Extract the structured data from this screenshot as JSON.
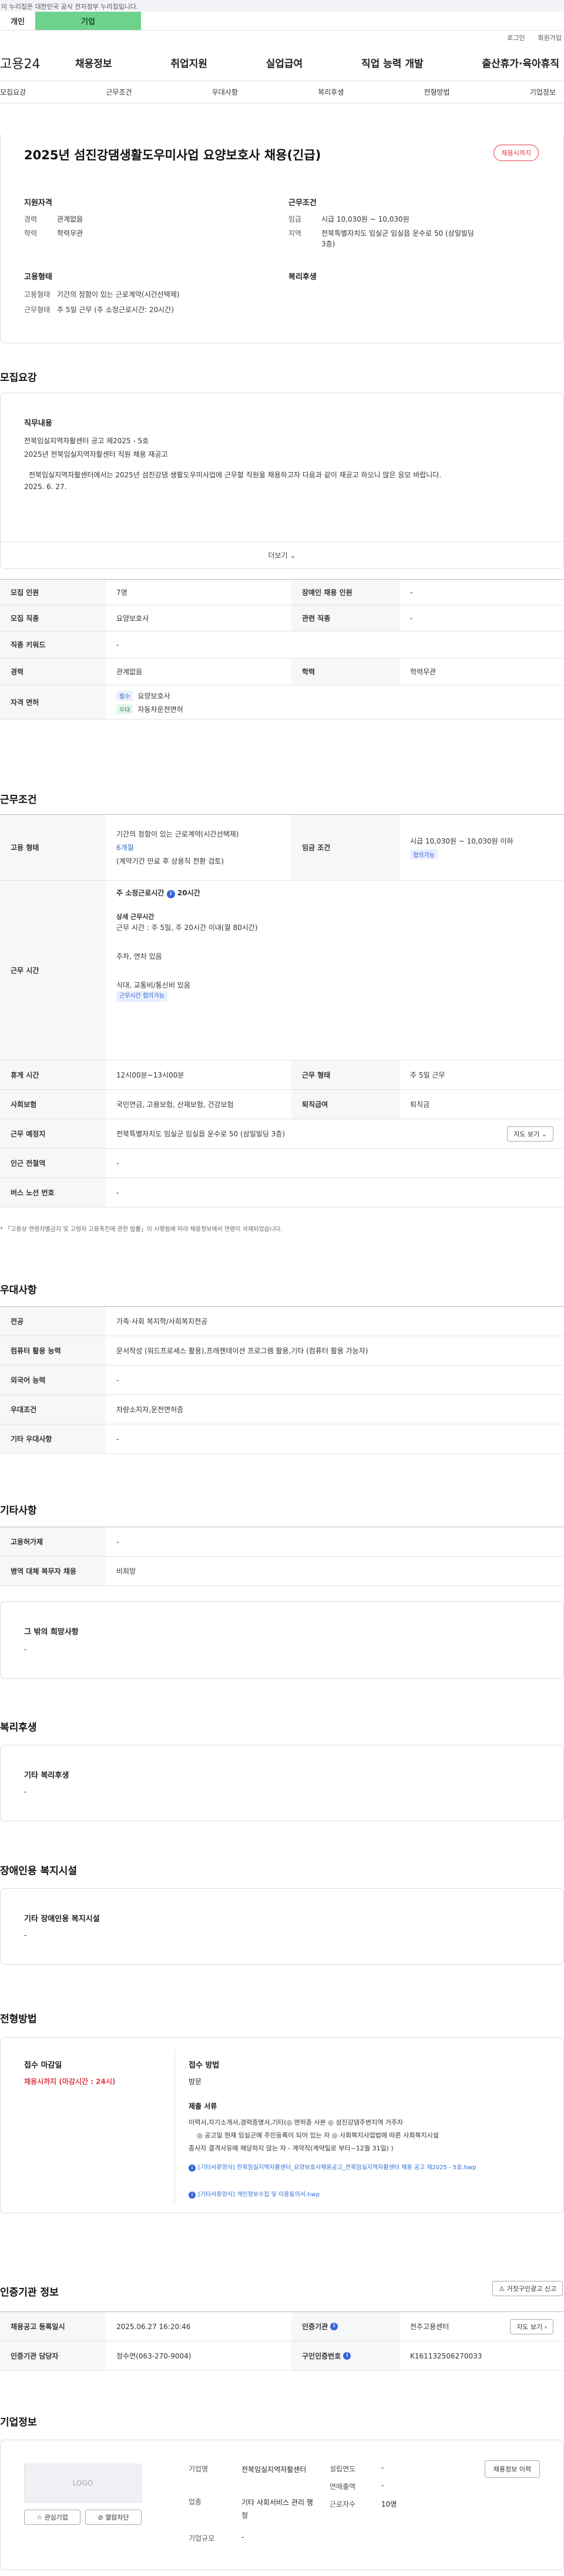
{
  "gov_banner": "이 누리집은 대한민국 공식 전자정부 누리집입니다.",
  "top_tabs": [
    "개인",
    "기업"
  ],
  "utility": {
    "login": "로그인",
    "signup": "회원가입"
  },
  "brand": {
    "logo": "고용24"
  },
  "gnb": [
    "채용정보",
    "취업지원",
    "실업급여",
    "직업 능력 개발",
    "출산휴가·육아휴직"
  ],
  "subtabs": [
    "모집요강",
    "근무조건",
    "우대사항",
    "복리후생",
    "전형방법",
    "기업정보"
  ],
  "summary": {
    "title": "2025년 섬진강댐생활도우미사업 요양보호사 채용(긴급)",
    "badge": "채용시까지",
    "qual_head": "지원자격",
    "qual": [
      {
        "k": "경력",
        "v": "관계없음"
      },
      {
        "k": "학력",
        "v": "학력무관"
      }
    ],
    "cond_head": "근무조건",
    "cond": [
      {
        "k": "임금",
        "v": "시급 10,030원 ~ 10,030원"
      },
      {
        "k": "지역",
        "v": "전북특별자치도 임실군 임실읍 운수로 50 (삼일빌딩 3층)"
      }
    ],
    "emp_head": "고용형태",
    "emp": [
      {
        "k": "고용형태",
        "v": "기간의 정함이 있는 근로계약(시간선택제)"
      },
      {
        "k": "근무형태",
        "v": "주 5일 근무 (주 소정근로시간: 20시간)"
      }
    ],
    "welfare_head": "복리후생"
  },
  "recruit": {
    "heading": "모집요강",
    "duty_head": "직무내용",
    "duty_lines": [
      "전북임실지역자활센터 공고 제2025 - 5호",
      "2025년 전북임실지역자활센터 직원 채용 재공고",
      "",
      "전북임실지역자활센터에서는 2025년 섬진강댐 생활도우미사업에 근무할 직원을 채용하고자 다음과 같이 재공고 하오니 많은 응모 바랍니다.",
      "2025.  6.  27."
    ],
    "more": "더보기",
    "rows": [
      {
        "k1": "모집 인원",
        "v1": "7명",
        "k2": "장애인 채용 인원",
        "v2": "-"
      },
      {
        "k1": "모집 직종",
        "v1": "요양보호사",
        "k2": "관련 직종",
        "v2": "-"
      },
      {
        "k1": "직종 키워드",
        "v1": "-"
      },
      {
        "k1": "경력",
        "v1": "관계없음",
        "k2": "학력",
        "v2": "학력무관"
      }
    ],
    "license_label": "자격 면허",
    "licenses": [
      {
        "tag": "필수",
        "name": "요양보호사"
      },
      {
        "tag": "우대",
        "name": "자동차운전면허"
      }
    ]
  },
  "work": {
    "heading": "근무조건",
    "emp_label": "고용 형태",
    "emp_value": "기간의 정함이 있는 근로계약(시간선택제)",
    "emp_period": "6개월",
    "emp_note": "(계약기간 만료 후 상용직 전환 검토)",
    "wage_label": "임금 조건",
    "wage_value": "시급 10,030원 ~ 10,030원 이하",
    "wage_chip": "협의가능",
    "time_label": "근무 시간",
    "time_weekly": "주 소정근로시간",
    "time_weekly_val": "20시간",
    "time_detail_head": "상세 근무시간",
    "time_detail": "근무 시간 : 주 5일, 주 20시간 이내(월 80시간)",
    "time_extra1": "주차, 연차 있음",
    "time_extra2": "식대, 교통비/통신비 있음",
    "time_chip": "근무시간 협의가능",
    "rows": [
      {
        "k1": "휴게 시간",
        "v1": "12시00분~13시00분",
        "k2": "근무 형태",
        "v2": "주 5일 근무"
      },
      {
        "k1": "사회보험",
        "v1": "국민연금, 고용보험, 산재보험, 건강보험",
        "k2": "퇴직급여",
        "v2": "퇴직금"
      }
    ],
    "place_label": "근무 예정지",
    "place_value": "전북특별자치도 임실군 임실읍 운수로 50 (삼일빌딩 3층)",
    "map_btn": "지도 보기",
    "station_label": "인근 전철역",
    "station_value": "-",
    "bus_label": "버스 노선 번호",
    "bus_value": "-",
    "footnote": "* 「고용상 연령차별금지 및 고령자 고용촉진에 관한 법률」이 시행됨에 따라 채용정보에서 연령이 삭제되었습니다."
  },
  "prefer": {
    "heading": "우대사항",
    "rows": [
      {
        "k": "전공",
        "v": "가족·사회 복지학/사회복지전공"
      },
      {
        "k": "컴퓨터 활용 능력",
        "v": "문서작성 (워드프로세스 활용),프레젠테이션 프로그램 활용,기타 (컴퓨터 활용 가능자)"
      },
      {
        "k": "외국어 능력",
        "v": "-"
      },
      {
        "k": "우대조건",
        "v": "차량소지자,운전면허증"
      },
      {
        "k": "기타 우대사항",
        "v": "-"
      }
    ]
  },
  "etc": {
    "heading": "기타사항",
    "rows": [
      {
        "k": "고용허가제",
        "v": "-"
      },
      {
        "k": "병역 대체 복무자 채용",
        "v": "비희망"
      }
    ],
    "hope_head": "그 밖의 희망사항",
    "hope_value": "-"
  },
  "welfare": {
    "heading": "복리후생",
    "sub": "기타 복리후생",
    "value": "-"
  },
  "disabled": {
    "heading": "장애인용 복지시설",
    "sub": "기타 장애인용 복지시설",
    "value": "-"
  },
  "screening": {
    "heading": "전형방법",
    "deadline_head": "접수 마감일",
    "deadline_val": "채용시까지 (마감시간 : 24시)",
    "method_head": "접수 방법",
    "method_val": "방문",
    "docs_head": "제출 서류",
    "docs_lines": [
      "이력서,자기소개서,경력증명서,기타(◎ 면허증 사본 ◎ 성진강댐주변지역 거주자",
      "◎ 공고일 현재 임실군에 주민등록이 되어 있는 자 ◎ 사회복지사업법에 따른 사회복지시설",
      "종사자 결격사유에 해당하지 않는 자 - 계약직(계약일로 부터~12월 31일) )"
    ],
    "file1": "[기타서류양식] 전북임실지역자활센터_요양보호사채용공고_전북임실지역자활센터 채용 공고 제2025 - 5호.hwp",
    "file2": "[기타서류양식] 개인정보수집 및 이용동의서.hwp"
  },
  "agency": {
    "heading": "인증기관 정보",
    "report_btn": "거짓구인광고 신고",
    "rows": [
      {
        "k1": "채용공고 등록일시",
        "v1": "2025.06.27 16:20:46",
        "k2": "인증기관",
        "v2": "전주고용센터"
      },
      {
        "k1": "인증기관 담당자",
        "v1": "정수연(063-270-9004)",
        "k2": "구인인증번호",
        "v2": "K161132506270033"
      }
    ],
    "map_btn": "지도 보기"
  },
  "company": {
    "heading": "기업정보",
    "logo": "LOGO",
    "fav_btn": "관심기업",
    "block_btn": "열람차단",
    "name_k": "기업명",
    "name_v": "전북임실지역자활센터",
    "biz_k": "업종",
    "biz_v": "기타 사회서비스 관리 행정",
    "size_k": "기업규모",
    "size_v": "-",
    "year_k": "설립연도",
    "year_v": "-",
    "sales_k": "연매출액",
    "sales_v": "-",
    "emp_k": "근로자수",
    "emp_v": "10명",
    "jobs_btn": "채용정보 이력"
  }
}
